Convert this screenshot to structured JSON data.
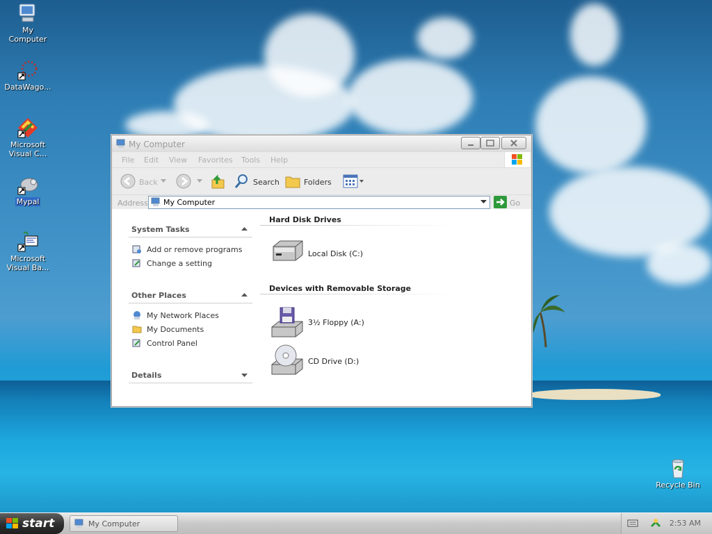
{
  "desktop": {
    "icons": [
      {
        "label": "My Computer",
        "icon": "my-computer-icon"
      },
      {
        "label": "DataWago...",
        "icon": "datawagon-icon"
      },
      {
        "label": "Microsoft Visual C...",
        "icon": "visual-c-icon"
      },
      {
        "label": "Mypal",
        "icon": "mypal-icon"
      },
      {
        "label": "Microsoft Visual Ba...",
        "icon": "visual-basic-icon"
      },
      {
        "label": "Recycle Bin",
        "icon": "recycle-bin-icon"
      }
    ]
  },
  "window": {
    "title": "My Computer",
    "menu": [
      "File",
      "Edit",
      "View",
      "Favorites",
      "Tools",
      "Help"
    ],
    "toolbar": {
      "back": "Back",
      "search": "Search",
      "folders": "Folders"
    },
    "address": {
      "label": "Address",
      "value": "My Computer",
      "go": "Go"
    },
    "tasks": {
      "system_tasks": {
        "title": "System Tasks",
        "items": [
          "Add or remove programs",
          "Change a setting"
        ]
      },
      "other_places": {
        "title": "Other Places",
        "items": [
          "My Network Places",
          "My Documents",
          "Control Panel"
        ]
      },
      "details": {
        "title": "Details"
      }
    },
    "groups": {
      "hard_disks": {
        "title": "Hard Disk Drives",
        "items": [
          "Local Disk (C:)"
        ]
      },
      "removable": {
        "title": "Devices with Removable Storage",
        "items": [
          "3½ Floppy (A:)",
          "CD Drive (D:)"
        ]
      }
    }
  },
  "taskbar": {
    "start": "start",
    "task": "My Computer",
    "clock": "2:53 AM"
  }
}
